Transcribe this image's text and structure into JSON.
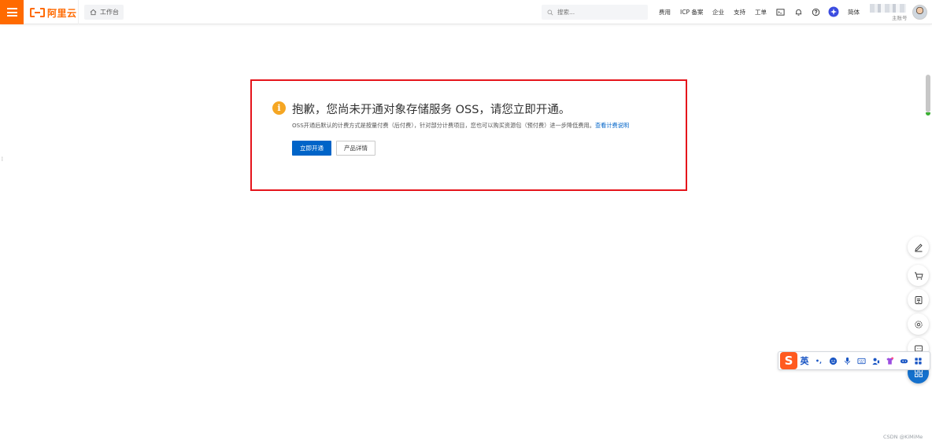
{
  "header": {
    "logo_text": "阿里云",
    "workbench_label": "工作台",
    "search_placeholder": "搜索...",
    "nav": {
      "fees": "费用",
      "icp": "ICP 备案",
      "enterprise": "企业",
      "support": "支持",
      "tickets": "工单",
      "language": "简体"
    },
    "user": {
      "sub_label": "主账号"
    }
  },
  "notice": {
    "title": "抱歉，您尚未开通对象存储服务 OSS，请您立即开通。",
    "description": "OSS开通后默认的计费方式是按量付费（后付费），针对部分计费项目，您也可以购买资源包（预付费）进一步降低费用。",
    "description_link": "查看计费说明",
    "primary_button": "立即开通",
    "secondary_button": "产品详情",
    "icon_glyph": "i"
  },
  "ime": {
    "logo": "S",
    "mode": "英",
    "punct": "•,"
  },
  "watermark": "CSDN @KiMiMe",
  "colors": {
    "brand_orange": "#ff6a00",
    "primary_blue": "#0064c8",
    "highlight_red": "#e5141b",
    "warning_yellow": "#f5a623"
  },
  "icons": [
    "menu-icon",
    "home-icon",
    "search-icon",
    "terminal-icon",
    "bell-icon",
    "help-icon",
    "ai-assistant-icon",
    "edit-icon",
    "cart-icon",
    "document-icon",
    "settings-icon",
    "message-icon",
    "grid-icon"
  ]
}
